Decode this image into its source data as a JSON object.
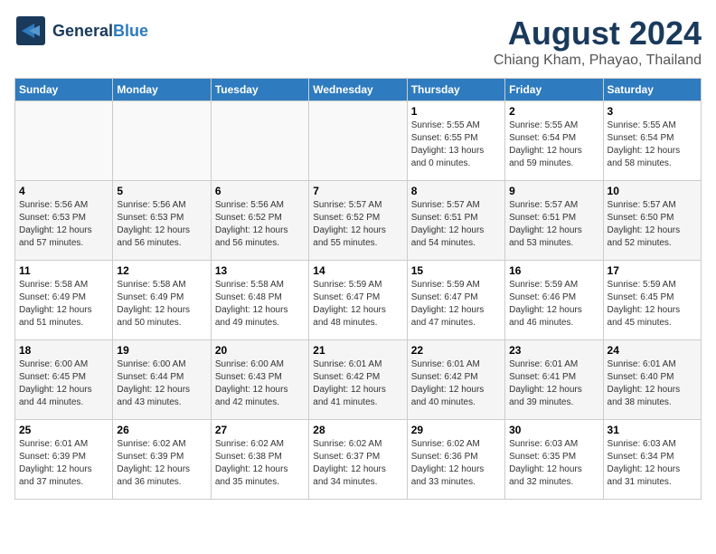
{
  "header": {
    "logo_general": "General",
    "logo_blue": "Blue",
    "title": "August 2024",
    "subtitle": "Chiang Kham, Phayao, Thailand"
  },
  "days_of_week": [
    "Sunday",
    "Monday",
    "Tuesday",
    "Wednesday",
    "Thursday",
    "Friday",
    "Saturday"
  ],
  "weeks": [
    [
      {
        "day": "",
        "info": ""
      },
      {
        "day": "",
        "info": ""
      },
      {
        "day": "",
        "info": ""
      },
      {
        "day": "",
        "info": ""
      },
      {
        "day": "1",
        "info": "Sunrise: 5:55 AM\nSunset: 6:55 PM\nDaylight: 13 hours\nand 0 minutes."
      },
      {
        "day": "2",
        "info": "Sunrise: 5:55 AM\nSunset: 6:54 PM\nDaylight: 12 hours\nand 59 minutes."
      },
      {
        "day": "3",
        "info": "Sunrise: 5:55 AM\nSunset: 6:54 PM\nDaylight: 12 hours\nand 58 minutes."
      }
    ],
    [
      {
        "day": "4",
        "info": "Sunrise: 5:56 AM\nSunset: 6:53 PM\nDaylight: 12 hours\nand 57 minutes."
      },
      {
        "day": "5",
        "info": "Sunrise: 5:56 AM\nSunset: 6:53 PM\nDaylight: 12 hours\nand 56 minutes."
      },
      {
        "day": "6",
        "info": "Sunrise: 5:56 AM\nSunset: 6:52 PM\nDaylight: 12 hours\nand 56 minutes."
      },
      {
        "day": "7",
        "info": "Sunrise: 5:57 AM\nSunset: 6:52 PM\nDaylight: 12 hours\nand 55 minutes."
      },
      {
        "day": "8",
        "info": "Sunrise: 5:57 AM\nSunset: 6:51 PM\nDaylight: 12 hours\nand 54 minutes."
      },
      {
        "day": "9",
        "info": "Sunrise: 5:57 AM\nSunset: 6:51 PM\nDaylight: 12 hours\nand 53 minutes."
      },
      {
        "day": "10",
        "info": "Sunrise: 5:57 AM\nSunset: 6:50 PM\nDaylight: 12 hours\nand 52 minutes."
      }
    ],
    [
      {
        "day": "11",
        "info": "Sunrise: 5:58 AM\nSunset: 6:49 PM\nDaylight: 12 hours\nand 51 minutes."
      },
      {
        "day": "12",
        "info": "Sunrise: 5:58 AM\nSunset: 6:49 PM\nDaylight: 12 hours\nand 50 minutes."
      },
      {
        "day": "13",
        "info": "Sunrise: 5:58 AM\nSunset: 6:48 PM\nDaylight: 12 hours\nand 49 minutes."
      },
      {
        "day": "14",
        "info": "Sunrise: 5:59 AM\nSunset: 6:47 PM\nDaylight: 12 hours\nand 48 minutes."
      },
      {
        "day": "15",
        "info": "Sunrise: 5:59 AM\nSunset: 6:47 PM\nDaylight: 12 hours\nand 47 minutes."
      },
      {
        "day": "16",
        "info": "Sunrise: 5:59 AM\nSunset: 6:46 PM\nDaylight: 12 hours\nand 46 minutes."
      },
      {
        "day": "17",
        "info": "Sunrise: 5:59 AM\nSunset: 6:45 PM\nDaylight: 12 hours\nand 45 minutes."
      }
    ],
    [
      {
        "day": "18",
        "info": "Sunrise: 6:00 AM\nSunset: 6:45 PM\nDaylight: 12 hours\nand 44 minutes."
      },
      {
        "day": "19",
        "info": "Sunrise: 6:00 AM\nSunset: 6:44 PM\nDaylight: 12 hours\nand 43 minutes."
      },
      {
        "day": "20",
        "info": "Sunrise: 6:00 AM\nSunset: 6:43 PM\nDaylight: 12 hours\nand 42 minutes."
      },
      {
        "day": "21",
        "info": "Sunrise: 6:01 AM\nSunset: 6:42 PM\nDaylight: 12 hours\nand 41 minutes."
      },
      {
        "day": "22",
        "info": "Sunrise: 6:01 AM\nSunset: 6:42 PM\nDaylight: 12 hours\nand 40 minutes."
      },
      {
        "day": "23",
        "info": "Sunrise: 6:01 AM\nSunset: 6:41 PM\nDaylight: 12 hours\nand 39 minutes."
      },
      {
        "day": "24",
        "info": "Sunrise: 6:01 AM\nSunset: 6:40 PM\nDaylight: 12 hours\nand 38 minutes."
      }
    ],
    [
      {
        "day": "25",
        "info": "Sunrise: 6:01 AM\nSunset: 6:39 PM\nDaylight: 12 hours\nand 37 minutes."
      },
      {
        "day": "26",
        "info": "Sunrise: 6:02 AM\nSunset: 6:39 PM\nDaylight: 12 hours\nand 36 minutes."
      },
      {
        "day": "27",
        "info": "Sunrise: 6:02 AM\nSunset: 6:38 PM\nDaylight: 12 hours\nand 35 minutes."
      },
      {
        "day": "28",
        "info": "Sunrise: 6:02 AM\nSunset: 6:37 PM\nDaylight: 12 hours\nand 34 minutes."
      },
      {
        "day": "29",
        "info": "Sunrise: 6:02 AM\nSunset: 6:36 PM\nDaylight: 12 hours\nand 33 minutes."
      },
      {
        "day": "30",
        "info": "Sunrise: 6:03 AM\nSunset: 6:35 PM\nDaylight: 12 hours\nand 32 minutes."
      },
      {
        "day": "31",
        "info": "Sunrise: 6:03 AM\nSunset: 6:34 PM\nDaylight: 12 hours\nand 31 minutes."
      }
    ]
  ]
}
